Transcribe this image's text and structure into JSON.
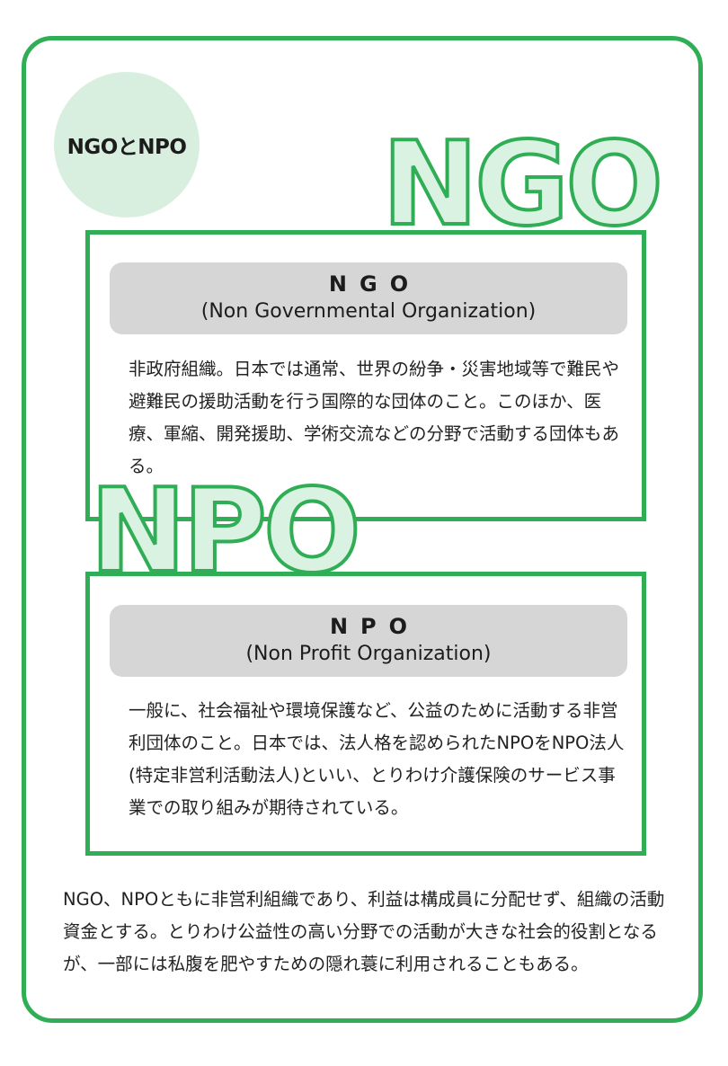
{
  "topic_label": "NGOとNPO",
  "ngo": {
    "big_word": "NGO",
    "abbr": "NGO",
    "full_name": "(Non Governmental Organization)",
    "description": "非政府組織。日本では通常、世界の紛争・災害地域等で難民や避難民の援助活動を行う国際的な団体のこと。このほか、医療、軍縮、開発援助、学術交流などの分野で活動する団体もある。"
  },
  "npo": {
    "big_word": "NPO",
    "abbr": "NPO",
    "full_name": "(Non Profit Organization)",
    "description": "一般に、社会福祉や環境保護など、公益のために活動する非営利団体のこと。日本では、法人格を認められたNPOをNPO法人(特定非営利活動法人)といい、とりわけ介護保険のサービス事業での取り組みが期待されている。"
  },
  "summary": "NGO、NPOともに非営利組織であり、利益は構成員に分配せず、組織の活動資金とする。とりわけ公益性の高い分野での活動が大きな社会的役割となるが、一部には私腹を肥やすための隠れ蓑に利用されることもある。",
  "colors": {
    "accent_green": "#2fae55",
    "light_green": "#d8efe0",
    "title_gray": "#d6d6d6"
  }
}
